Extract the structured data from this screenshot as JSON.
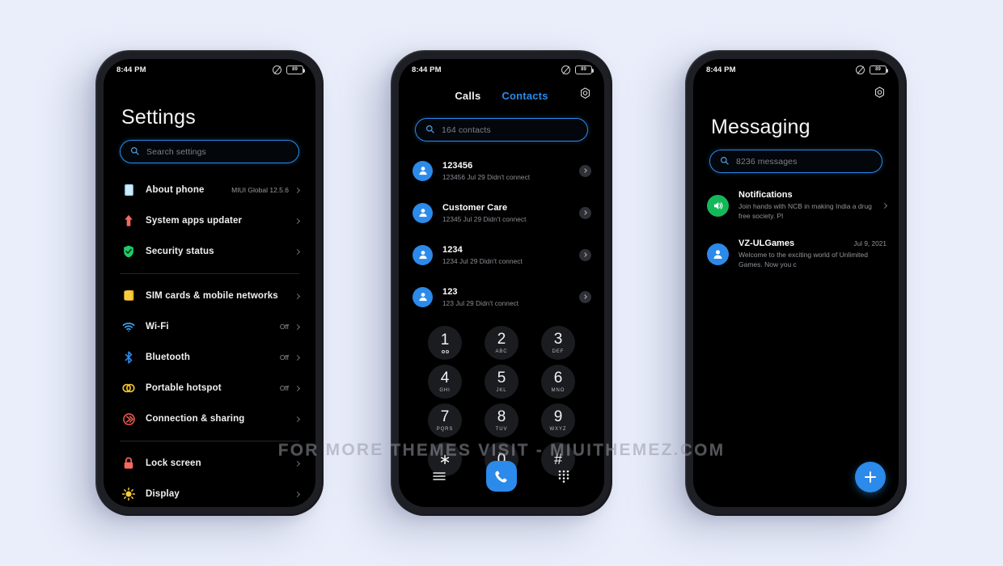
{
  "background_color": "#eaeefb",
  "accent_color": "#2b8aea",
  "watermark": "FOR MORE THEMES VISIT - MIUITHEMEZ.COM",
  "status_bar": {
    "time": "8:44 PM",
    "battery_text": "89",
    "dnd_icon": "do-not-disturb-icon",
    "battery_icon": "battery-icon"
  },
  "settings_phone": {
    "title": "Settings",
    "search": {
      "placeholder": "Search settings",
      "icon": "search-icon"
    },
    "groups": [
      {
        "items": [
          {
            "icon": "about-phone-icon",
            "color": "#8fd3f7",
            "label": "About phone",
            "value": "MIUI Global 12.5.6"
          },
          {
            "icon": "system-updater-icon",
            "color": "#f4695f",
            "label": "System apps updater",
            "value": ""
          },
          {
            "icon": "security-shield-icon",
            "color": "#1ecb6a",
            "label": "Security status",
            "value": ""
          }
        ]
      },
      {
        "items": [
          {
            "icon": "sim-card-icon",
            "color": "#f2c230",
            "label": "SIM cards & mobile networks",
            "value": ""
          },
          {
            "icon": "wifi-icon",
            "color": "#3e9fe8",
            "label": "Wi-Fi",
            "value": "Off"
          },
          {
            "icon": "bluetooth-icon",
            "color": "#2b8aea",
            "label": "Bluetooth",
            "value": "Off"
          },
          {
            "icon": "hotspot-icon",
            "color": "#f2c230",
            "label": "Portable hotspot",
            "value": "Off"
          },
          {
            "icon": "connection-sharing-icon",
            "color": "#e2574c",
            "label": "Connection & sharing",
            "value": ""
          }
        ]
      },
      {
        "items": [
          {
            "icon": "lock-screen-icon",
            "color": "#f4695f",
            "label": "Lock screen",
            "value": ""
          },
          {
            "icon": "display-brightness-icon",
            "color": "#f2c230",
            "label": "Display",
            "value": ""
          }
        ]
      }
    ]
  },
  "dialer_phone": {
    "tabs": [
      {
        "label": "Calls",
        "active": false
      },
      {
        "label": "Contacts",
        "active": true
      }
    ],
    "settings_icon": "gear-icon",
    "search": {
      "placeholder": "164 contacts",
      "icon": "search-icon"
    },
    "contacts": [
      {
        "name": "123456",
        "subtitle": "123456  Jul 29 Didn't connect"
      },
      {
        "name": "Customer Care",
        "subtitle": "12345  Jul 29 Didn't connect"
      },
      {
        "name": "1234",
        "subtitle": "1234  Jul 29 Didn't connect"
      },
      {
        "name": "123",
        "subtitle": "123  Jul 29 Didn't connect"
      }
    ],
    "keypad": [
      {
        "digit": "1",
        "letters": "",
        "voicemail": true
      },
      {
        "digit": "2",
        "letters": "ABC"
      },
      {
        "digit": "3",
        "letters": "DEF"
      },
      {
        "digit": "4",
        "letters": "GHI"
      },
      {
        "digit": "5",
        "letters": "JKL"
      },
      {
        "digit": "6",
        "letters": "MNO"
      },
      {
        "digit": "7",
        "letters": "PQRS"
      },
      {
        "digit": "8",
        "letters": "TUV"
      },
      {
        "digit": "9",
        "letters": "WXYZ"
      },
      {
        "digit": "∗",
        "letters": ""
      },
      {
        "digit": "0",
        "letters": "+"
      },
      {
        "digit": "#",
        "letters": ""
      }
    ],
    "bottom_nav": [
      {
        "icon": "menu-icon"
      },
      {
        "icon": "call-icon"
      },
      {
        "icon": "dialpad-icon"
      }
    ]
  },
  "messaging_phone": {
    "title": "Messaging",
    "settings_icon": "gear-icon",
    "search": {
      "placeholder": "8236 messages",
      "icon": "search-icon"
    },
    "threads": [
      {
        "avatar": "speaker-icon",
        "avatar_color": "#14b85a",
        "name": "Notifications",
        "date": "",
        "preview": "Join hands with NCB in making India a drug free society. Pl",
        "has_chevron": true
      },
      {
        "avatar": "person-icon",
        "avatar_color": "#2b8aea",
        "name": "VZ-ULGames",
        "date": "Jul 9, 2021",
        "preview": "Welcome to the exciting world of Unlimited Games. Now you c",
        "has_chevron": false
      }
    ],
    "fab": {
      "icon": "plus-icon"
    }
  }
}
